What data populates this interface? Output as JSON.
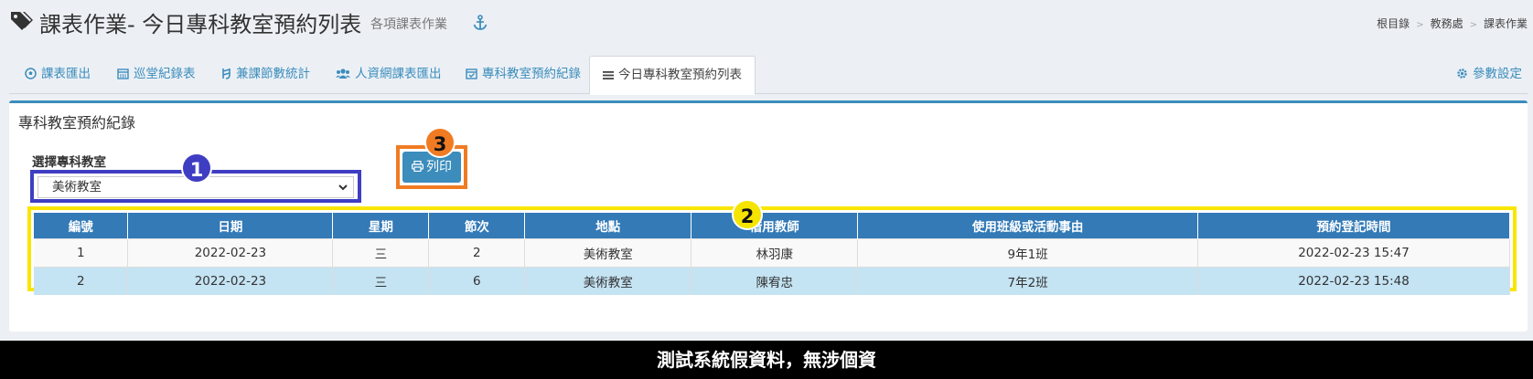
{
  "header": {
    "title": "課表作業- 今日專科教室預約列表",
    "subtitle": "各項課表作業",
    "icon": "tags-icon",
    "breadcrumb": [
      "根目錄",
      "教務處",
      "課表作業"
    ]
  },
  "tabs": [
    {
      "label": "課表匯出",
      "icon": "futbol-icon"
    },
    {
      "label": "巡堂紀錄表",
      "icon": "calendar-icon"
    },
    {
      "label": "兼課節數統計",
      "icon": "currency-icon"
    },
    {
      "label": "人資網課表匯出",
      "icon": "users-icon"
    },
    {
      "label": "專科教室預約紀錄",
      "icon": "calendar-check-icon"
    },
    {
      "label": "今日專科教室預約列表",
      "icon": "list-icon",
      "active": true
    },
    {
      "label": "參數設定",
      "icon": "gear-icon"
    }
  ],
  "panel": {
    "title": "專科教室預約紀錄",
    "select_label": "選擇專科教室",
    "select_value": "美術教室",
    "print_label": "列印",
    "badges": [
      "1",
      "2",
      "3"
    ]
  },
  "table": {
    "headers": [
      "編號",
      "日期",
      "星期",
      "節次",
      "地點",
      "借用教師",
      "使用班級或活動事由",
      "預約登記時間"
    ],
    "rows": [
      [
        "1",
        "2022-02-23",
        "三",
        "2",
        "美術教室",
        "林羽康",
        "9年1班",
        "2022-02-23 15:47"
      ],
      [
        "2",
        "2022-02-23",
        "三",
        "6",
        "美術教室",
        "陳宥忠",
        "7年2班",
        "2022-02-23 15:48"
      ]
    ]
  },
  "footer": {
    "text": "測試系統假資料，無涉個資"
  },
  "colors": {
    "accent": "#3c8dbc",
    "header_row": "#337ab7",
    "badge1": "#3f3ec3",
    "badge2": "#f5e400",
    "badge3": "#f07b22"
  }
}
